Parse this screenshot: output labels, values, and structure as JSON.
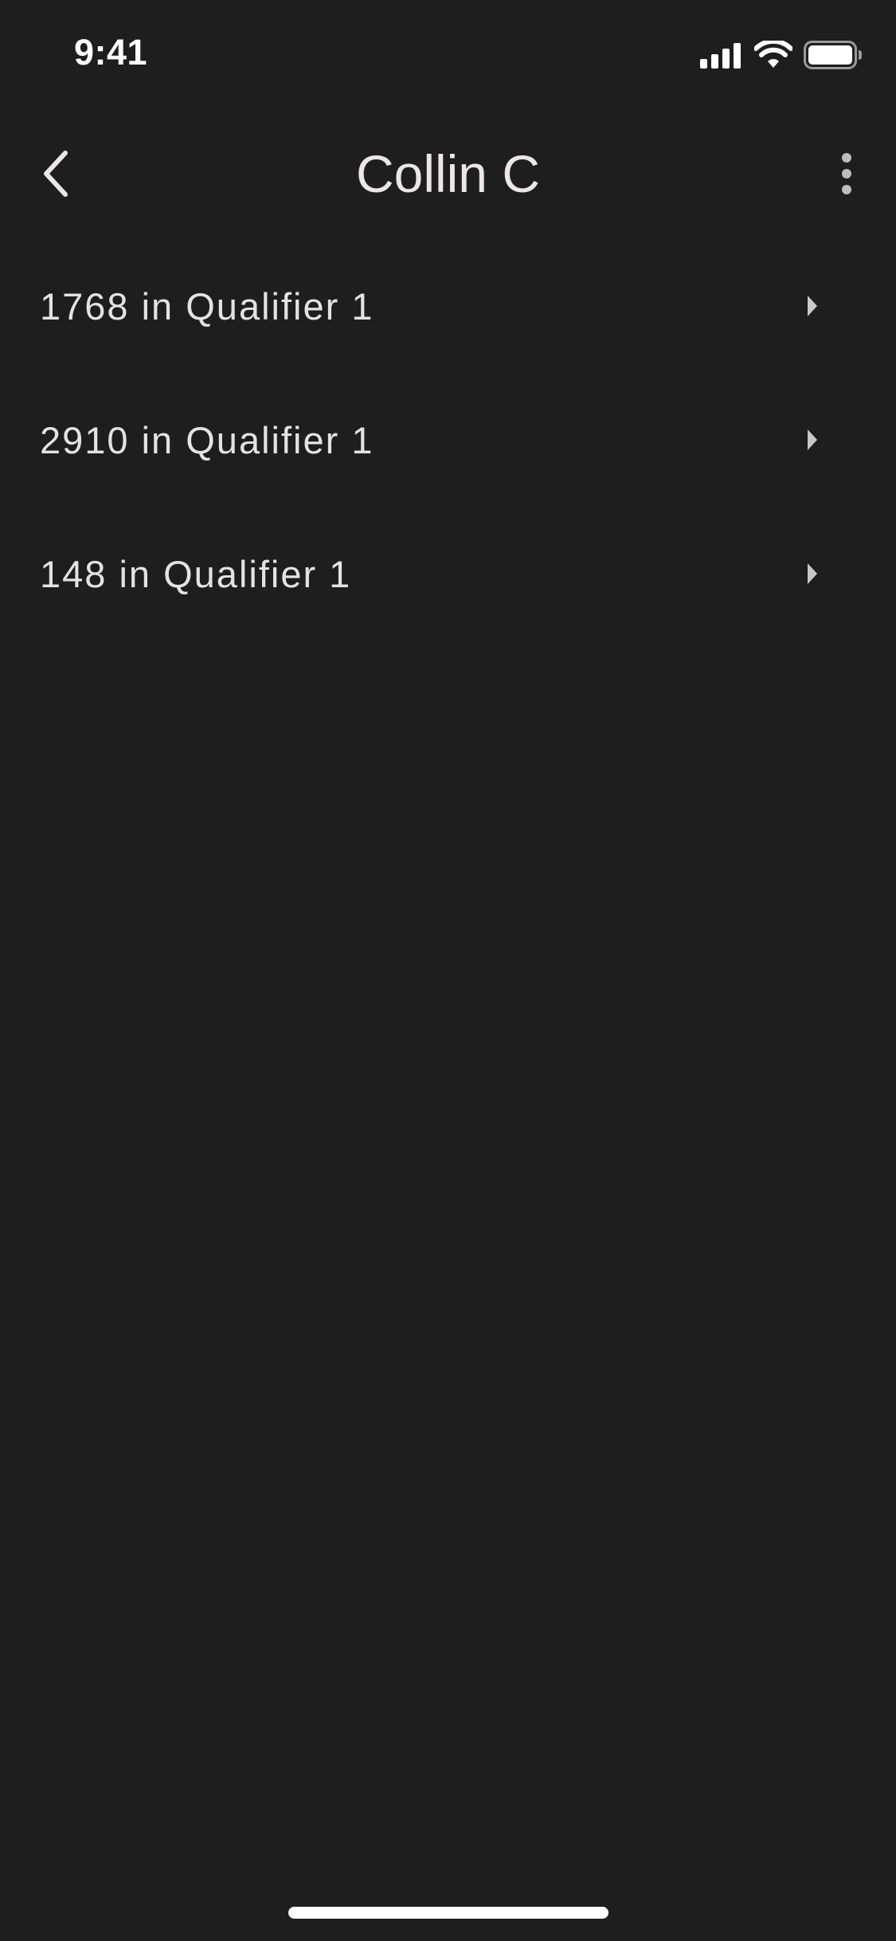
{
  "status_bar": {
    "time": "9:41"
  },
  "nav": {
    "title": "Collin C",
    "back_icon": "chevron-left-icon",
    "more_icon": "more-vertical-icon"
  },
  "list": {
    "items": [
      {
        "label": "1768 in Qualifier 1"
      },
      {
        "label": "2910 in Qualifier 1"
      },
      {
        "label": "148 in Qualifier 1"
      }
    ]
  },
  "colors": {
    "background": "#1e1e1e",
    "text": "#e8e4e4",
    "icon": "#cfcfcf"
  }
}
